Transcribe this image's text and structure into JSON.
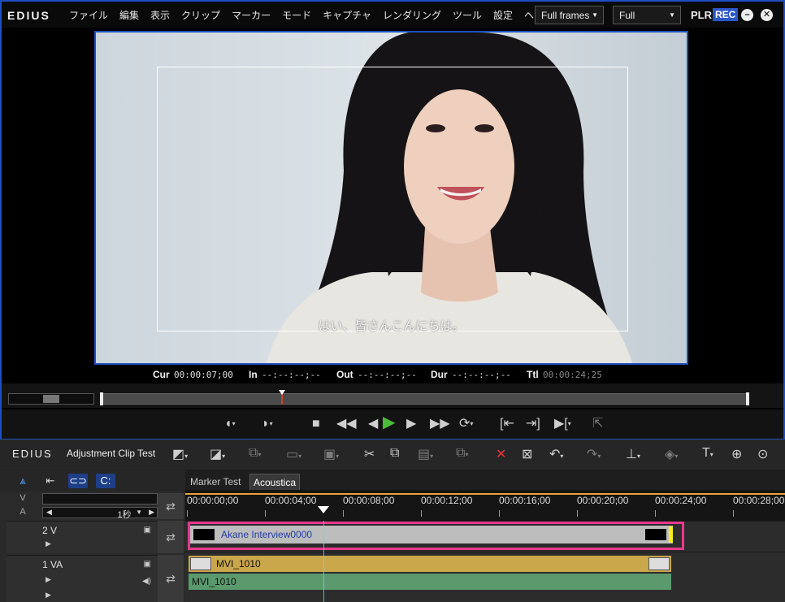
{
  "app": {
    "name": "EDIUS"
  },
  "menu": [
    "ファイル",
    "編集",
    "表示",
    "クリップ",
    "マーカー",
    "モード",
    "キャプチャ",
    "レンダリング",
    "ツール",
    "設定",
    "ヘルプ"
  ],
  "menu_more": "▸",
  "player": {
    "frames_dropdown": "Full frames",
    "quality_dropdown": "Full",
    "plr_label": "PLR",
    "rec_label": "REC",
    "subtitle": "はい、皆さんこんにちは。",
    "timecodes": {
      "cur_label": "Cur",
      "cur_value": "00:00:07;00",
      "in_label": "In",
      "in_value": "--:--:--;--",
      "out_label": "Out",
      "out_value": "--:--:--;--",
      "dur_label": "Dur",
      "dur_value": "--:--:--;--",
      "ttl_label": "Ttl",
      "ttl_value": "00:00:24;25"
    }
  },
  "timeline": {
    "logo": "EDIUS",
    "sequence_name": "Adjustment Clip Test",
    "tabs": [
      "Marker Test",
      "Acoustica"
    ],
    "active_tab": "Acoustica",
    "v_label": "V",
    "a_label": "A",
    "zoom": "1秒",
    "ruler": [
      "00:00:00;00",
      "00:00:04;00",
      "00:00:08;00",
      "00:00:12;00",
      "00:00:16;00",
      "00:00:20;00",
      "00:00:24;00",
      "00:00:28;00"
    ],
    "tracks": [
      {
        "name": "2 V",
        "clip": "Akane Interview0000"
      },
      {
        "name": "1 VA",
        "video_clip": "MVI_1010",
        "audio_clip": "MVI_1010"
      }
    ]
  },
  "colors": {
    "accent_blue": "#1f4fbf",
    "highlight_pink": "#e8388f",
    "video_clip": "#c9a74a",
    "audio_clip": "#5a9a6d",
    "ruler_orange": "#e9a23b"
  }
}
